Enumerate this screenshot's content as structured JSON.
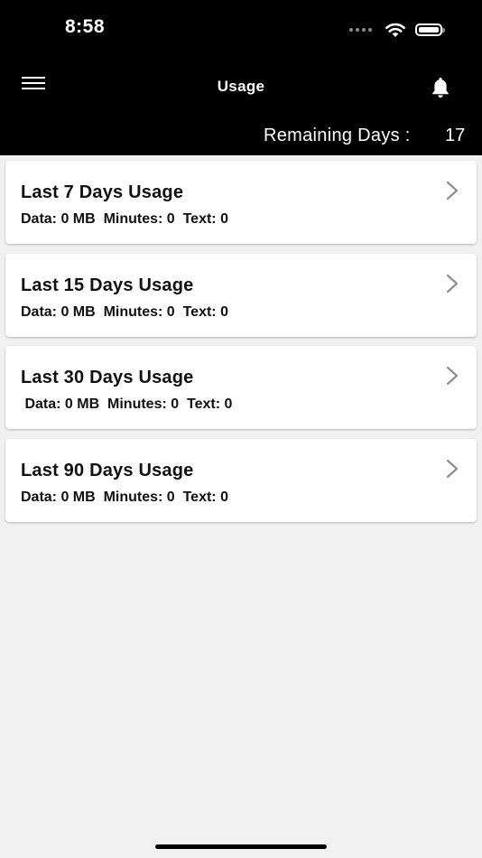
{
  "status_bar": {
    "time": "8:58"
  },
  "header": {
    "title": "Usage",
    "remaining_label": "Remaining Days :",
    "remaining_value": "17"
  },
  "cards": [
    {
      "title": "Last 7 Days Usage",
      "details": "Data: 0 MB  Minutes: 0  Text: 0"
    },
    {
      "title": "Last 15 Days Usage",
      "details": "Data: 0 MB  Minutes: 0  Text: 0"
    },
    {
      "title": "Last 30 Days Usage",
      "details": " Data: 0 MB  Minutes: 0  Text: 0"
    },
    {
      "title": "Last 90 Days Usage",
      "details": "Data: 0 MB  Minutes: 0  Text: 0"
    }
  ],
  "icons": {
    "menu": "hamburger-menu-icon",
    "notifications": "bell-icon",
    "card_arrow": "chevron-right-icon"
  },
  "colors": {
    "header_bg": "#000000",
    "page_bg": "#f1f1f1",
    "card_bg": "#ffffff",
    "chevron": "#8e8e8e"
  }
}
